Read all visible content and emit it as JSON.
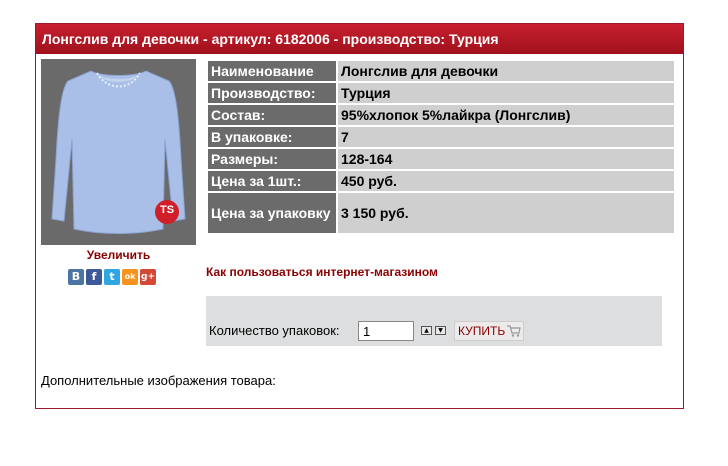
{
  "header": {
    "title": "Лонгслив для девочки - артикул: 6182006 - производство: Турция"
  },
  "image": {
    "zoom_label": "Увеличить",
    "brand_badge": "TS"
  },
  "social": [
    {
      "icon": "vk-icon",
      "glyph": "B",
      "color": "#4c75a3"
    },
    {
      "icon": "facebook-icon",
      "glyph": "f",
      "color": "#3b5998"
    },
    {
      "icon": "twitter-icon",
      "glyph": "t",
      "color": "#2ea7e0"
    },
    {
      "icon": "odnoklassniki-icon",
      "glyph": "ok",
      "color": "#f7931e"
    },
    {
      "icon": "google-plus-icon",
      "glyph": "g+",
      "color": "#d34836"
    }
  ],
  "specs": [
    {
      "key": "Наименование",
      "value": "Лонгслив для девочки"
    },
    {
      "key": "Производство:",
      "value": "Турция"
    },
    {
      "key": "Состав:",
      "value": "95%хлопок 5%лайкра (Лонгслив)"
    },
    {
      "key": "В упаковке:",
      "value": "7"
    },
    {
      "key": "Размеры:",
      "value": "128-164"
    },
    {
      "key": "Цена за 1шт.:",
      "value": "450 руб."
    },
    {
      "key": "Цена за упаковку",
      "value": "3 150 руб."
    }
  ],
  "help_link": "Как пользоваться интернет-магазином",
  "order": {
    "qty_label": "Количество упаковок:",
    "qty_value": "1",
    "buy_label": "КУПИТЬ"
  },
  "extra_images_label": "Дополнительные изображения товара:",
  "colors": {
    "header": "#b5141f",
    "accent": "#8b0000",
    "spec_key_bg": "#6b6b6b",
    "spec_val_bg": "#cfcfcf"
  }
}
